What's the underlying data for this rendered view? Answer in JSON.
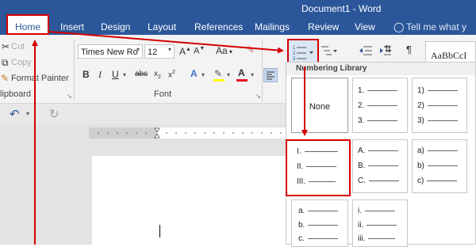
{
  "window": {
    "title": "Document1 - Word"
  },
  "tabs": [
    "Home",
    "Insert",
    "Design",
    "Layout",
    "References",
    "Mailings",
    "Review",
    "View"
  ],
  "tell_me": "Tell me what y",
  "clipboard": {
    "cut": "Cut",
    "copy": "Copy",
    "format_painter": "Format Painter",
    "label": "lipboard"
  },
  "font": {
    "name": "Times New Ro",
    "size": "12",
    "label": "Font",
    "change_case": "Aa",
    "grow": "A",
    "shrink": "A"
  },
  "styles_preview": "AaBbCcI",
  "numbering": {
    "header": "Numbering Library",
    "none_label": "None",
    "formats": [
      {
        "items": [
          "1.",
          "2.",
          "3."
        ]
      },
      {
        "items": [
          "1)",
          "2)",
          "3)"
        ]
      },
      {
        "items": [
          "I.",
          "II.",
          "III."
        ]
      },
      {
        "items": [
          "A.",
          "B.",
          "C."
        ]
      },
      {
        "items": [
          "a)",
          "b)",
          "c)"
        ]
      },
      {
        "items": [
          "a.",
          "b.",
          "c."
        ]
      },
      {
        "items": [
          "i.",
          "ii.",
          "iii."
        ]
      }
    ]
  },
  "colors": {
    "accent": "#2b579a",
    "highlight_red": "#d40000",
    "font_color_bar": "#e81123"
  },
  "icons": [
    "cut-icon",
    "copy-icon",
    "format-painter-icon",
    "undo-icon",
    "redo-icon",
    "numbering-icon",
    "bullets-icon",
    "multilevel-list-icon",
    "sort-icon",
    "pilcrow-icon",
    "lightbulb-icon",
    "grow-font-icon",
    "shrink-font-icon",
    "clear-formatting-icon"
  ]
}
